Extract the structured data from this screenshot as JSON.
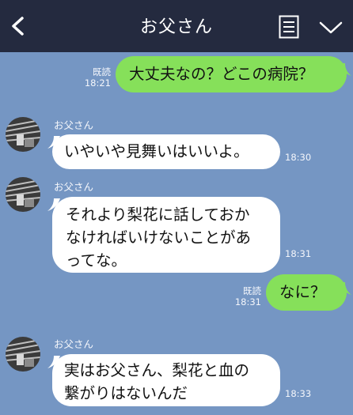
{
  "header": {
    "title": "お父さん",
    "back_icon": "chevron-left-icon",
    "menu_icon": "notes-icon",
    "dropdown_icon": "chevron-down-icon"
  },
  "messages": [
    {
      "side": "right",
      "lines": [
        "大丈夫なの？どこの病院？"
      ],
      "read": "既読",
      "time": "18:21"
    },
    {
      "side": "left",
      "sender": "お父さん",
      "lines": [
        "いやいや見舞いはいいよ。"
      ],
      "time": "18:30"
    },
    {
      "side": "left",
      "sender": "お父さん",
      "lines": [
        "それより梨花に話しておか",
        "なければいけないことがあ",
        "ってな。"
      ],
      "time": "18:31"
    },
    {
      "side": "right",
      "lines": [
        "なに？"
      ],
      "read": "既読",
      "time": "18:31"
    },
    {
      "side": "left",
      "sender": "お父さん",
      "lines": [
        "実はお父さん、梨花と血の",
        "繋がりはないんだ"
      ],
      "time": "18:33"
    }
  ],
  "colors": {
    "header_bg": "#242a3f",
    "chat_bg": "#7596c3",
    "sent_bubble": "#86e05a",
    "received_bubble": "#ffffff"
  }
}
